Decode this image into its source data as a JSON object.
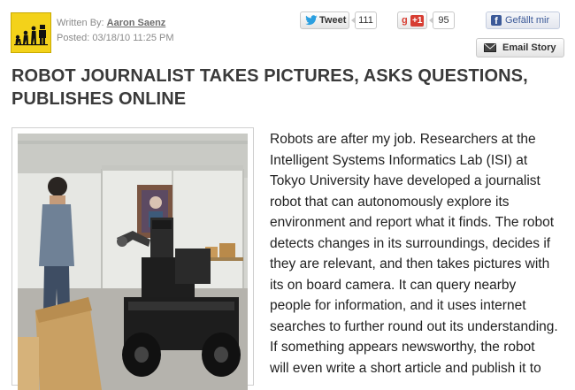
{
  "author": {
    "written_by_label": "Written By:",
    "name": "Aaron Saenz",
    "posted": "Posted: 03/18/10 11:25 PM"
  },
  "share": {
    "tweet_label": "Tweet",
    "tweet_count": "111",
    "plusone_label": "+1",
    "plusone_count": "95",
    "facebook_label": "Gefällt mir",
    "email_label": "Email Story"
  },
  "article": {
    "title_line1": "ROBOT JOURNALIST TAKES PICTURES, ASKS QUESTIONS,",
    "title_line2": "PUBLISHES ONLINE",
    "lines": [
      "Robots are after my job. Researchers at the",
      "Intelligent Systems Informatics Lab (ISI) at",
      "Tokyo University have developed a journalist",
      "robot that can autonomously explore its",
      "environment and report what it finds. The robot",
      "detects changes in its surroundings, decides if",
      "they are relevant, and then takes pictures with",
      "its on board camera. It can query nearby",
      "people for information, and it uses internet",
      "searches to further round out its understanding.",
      "If something appears newsworthy, the robot",
      "will even write a short article and publish it to"
    ]
  },
  "colors": {
    "logo_bg": "#f3d21a",
    "headline": "#3a3a3a",
    "twitter_blue": "#2b9fe0",
    "gplus_red": "#d73d32",
    "facebook_blue": "#3b5998"
  }
}
